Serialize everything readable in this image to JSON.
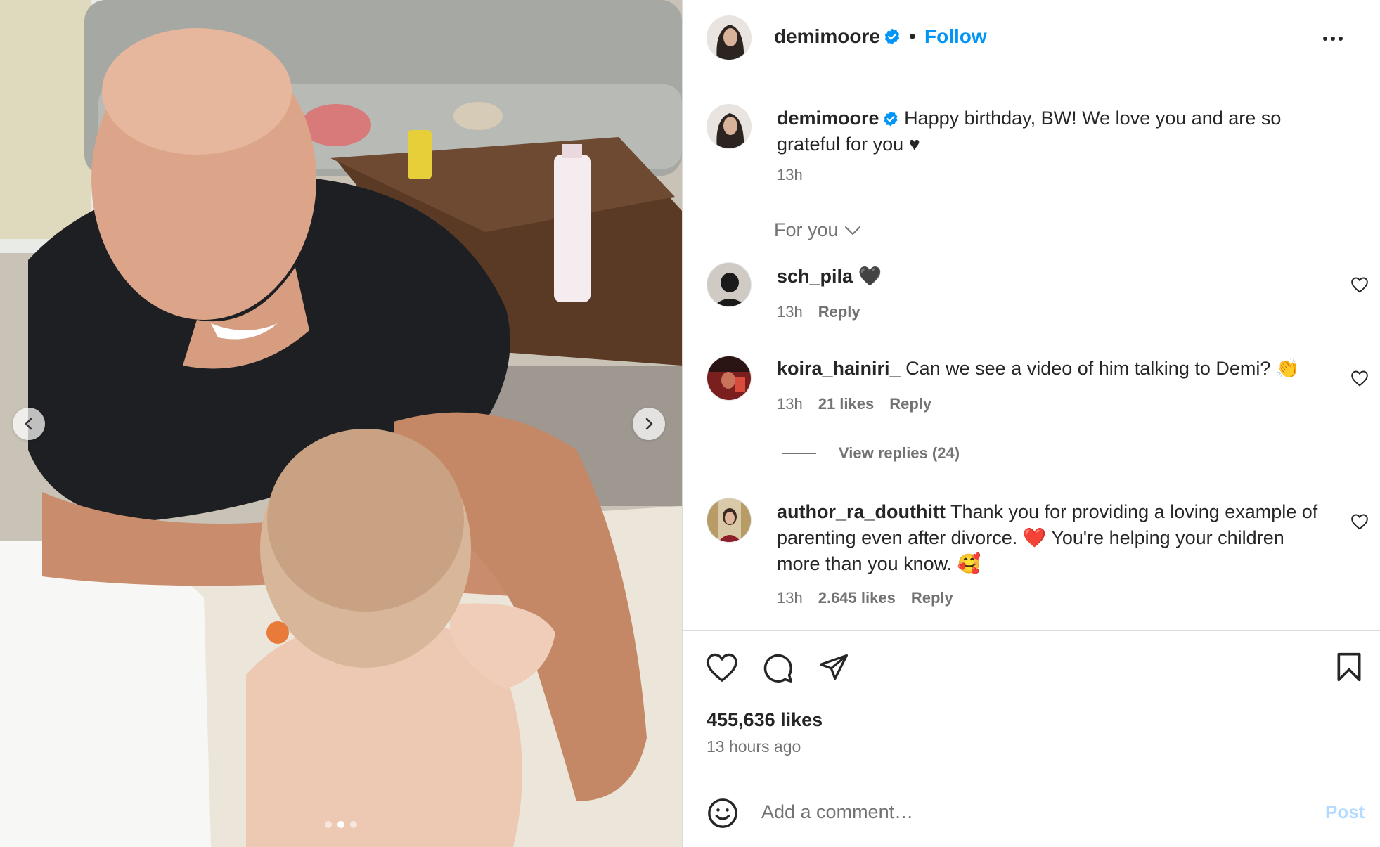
{
  "media": {
    "dots_total": 3,
    "dots_active_index": 1
  },
  "header": {
    "username": "demimoore",
    "separator": "•",
    "follow_label": "Follow"
  },
  "caption": {
    "username": "demimoore",
    "text": "Happy birthday, BW! We love you and are so grateful for you ♥",
    "time": "13h"
  },
  "sort": {
    "label": "For you"
  },
  "comments": [
    {
      "username": "sch_pila",
      "text": "🖤",
      "time": "13h",
      "likes": "",
      "reply_label": "Reply"
    },
    {
      "username": "koira_hainiri_",
      "text": "Can we see a video of him talking to Demi? 👏",
      "time": "13h",
      "likes": "21 likes",
      "reply_label": "Reply",
      "view_replies": "View replies (24)"
    },
    {
      "username": "author_ra_douthitt",
      "text": "Thank you for providing a loving example of parenting even after divorce. ❤️  You're helping your children more than you know. 🥰",
      "time": "13h",
      "likes": "2.645 likes",
      "reply_label": "Reply"
    }
  ],
  "post": {
    "likes": "455,636 likes",
    "time_ago": "13 hours ago"
  },
  "composer": {
    "placeholder": "Add a comment…",
    "post_label": "Post"
  },
  "colors": {
    "link_blue": "#0095f6",
    "verified_blue": "#0095f6",
    "post_disabled": "#b3dbff",
    "muted_text": "#737373",
    "divider": "#dbdbdb"
  }
}
